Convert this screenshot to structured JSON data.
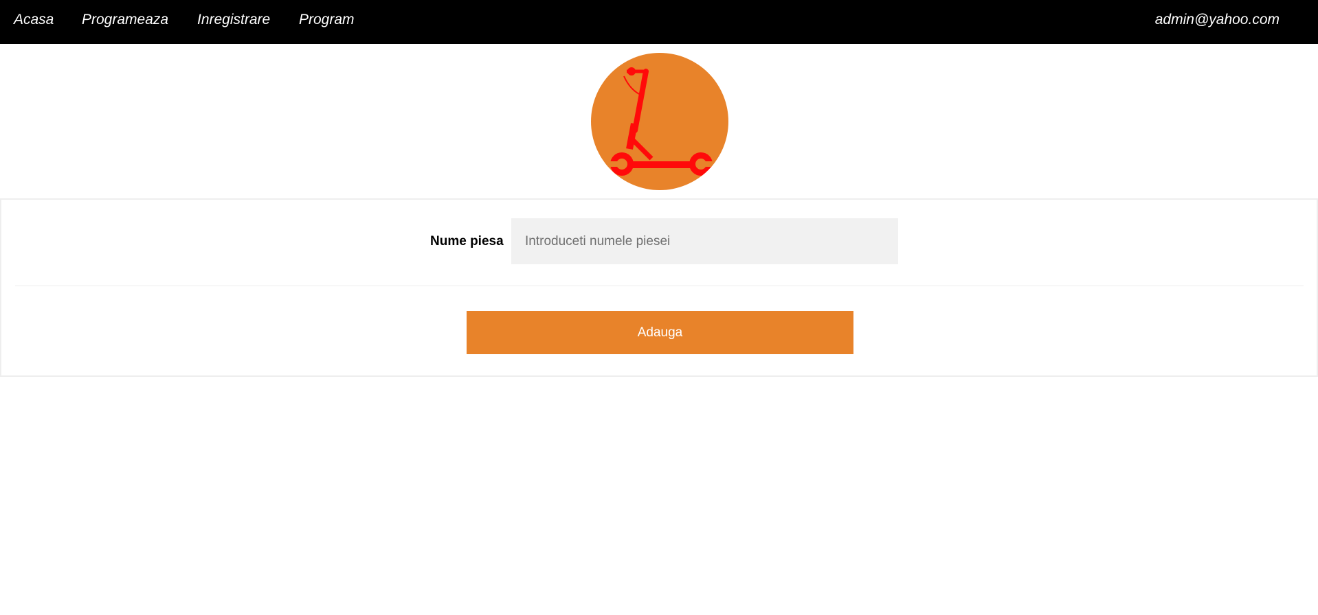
{
  "nav": {
    "links": [
      "Acasa",
      "Programeaza",
      "Inregistrare",
      "Program"
    ],
    "user_email": "admin@yahoo.com"
  },
  "logo": {
    "icon": "scooter-wrench-icon",
    "circle_color": "#E8832A",
    "icon_color": "#FF0A0A"
  },
  "form": {
    "part_name_label": "Nume piesa",
    "part_name_placeholder": "Introduceti numele piesei",
    "part_name_value": "",
    "submit_label": "Adauga"
  },
  "colors": {
    "navbar": "#000000",
    "accent": "#E8832A",
    "input_bg": "#F1F1F1"
  }
}
